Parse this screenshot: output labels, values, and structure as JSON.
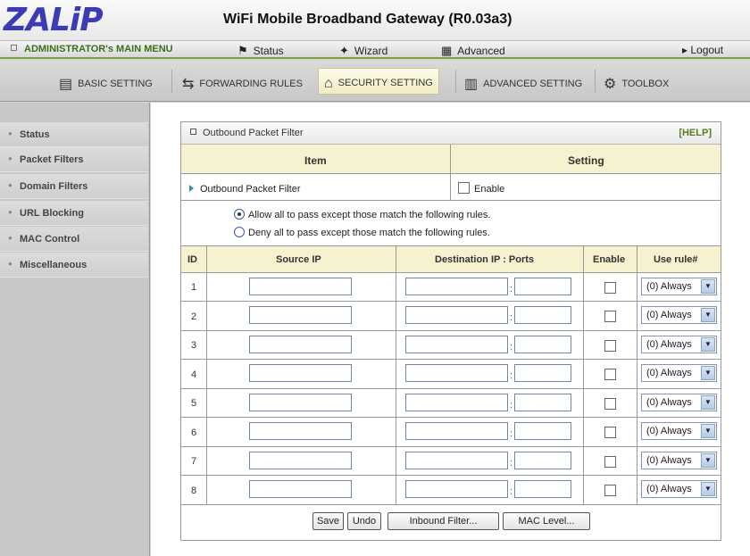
{
  "brand": {
    "logo": "ZALiP",
    "title": "WiFi Mobile Broadband Gateway (R0.03a3)"
  },
  "menu": {
    "admin_label": "ADMINISTRATOR's MAIN MENU",
    "status": "Status",
    "wizard": "Wizard",
    "advanced": "Advanced",
    "logout": "▸ Logout"
  },
  "tabs": [
    {
      "label": "BASIC SETTING",
      "icon": "basic-setting-icon",
      "active": false
    },
    {
      "label": "FORWARDING RULES",
      "icon": "forwarding-icon",
      "active": false
    },
    {
      "label": "SECURITY SETTING",
      "icon": "security-icon",
      "active": true
    },
    {
      "label": "ADVANCED SETTING",
      "icon": "advanced-setting-icon",
      "active": false
    },
    {
      "label": "TOOLBOX",
      "icon": "toolbox-icon",
      "active": false
    }
  ],
  "sidebar": {
    "items": [
      {
        "label": "Status"
      },
      {
        "label": "Packet Filters"
      },
      {
        "label": "Domain Filters"
      },
      {
        "label": "URL Blocking"
      },
      {
        "label": "MAC Control"
      },
      {
        "label": "Miscellaneous"
      }
    ]
  },
  "panel": {
    "title": "Outbound Packet Filter",
    "help": "[HELP]",
    "col_item": "Item",
    "col_setting": "Setting",
    "filter_label": "Outbound Packet Filter",
    "enable_label": "Enable",
    "radio_allow": "Allow all to pass except those match the following rules.",
    "radio_deny": "Deny all to pass except those match the following rules.",
    "rule_headers": {
      "id": "ID",
      "source_ip": "Source IP",
      "dest": "Destination IP : Ports",
      "enable": "Enable",
      "use_rule": "Use rule#"
    },
    "rows": [
      {
        "id": "1",
        "rule": "(0) Always"
      },
      {
        "id": "2",
        "rule": "(0) Always"
      },
      {
        "id": "3",
        "rule": "(0) Always"
      },
      {
        "id": "4",
        "rule": "(0) Always"
      },
      {
        "id": "5",
        "rule": "(0) Always"
      },
      {
        "id": "6",
        "rule": "(0) Always"
      },
      {
        "id": "7",
        "rule": "(0) Always"
      },
      {
        "id": "8",
        "rule": "(0) Always"
      }
    ],
    "buttons": {
      "save": "Save",
      "undo": "Undo",
      "inbound": "Inbound Filter...",
      "mac": "MAC Level..."
    }
  },
  "colors": {
    "accent_green": "#7aa23a",
    "header_bg": "#f6f2d0",
    "logo_blue": "#3b3bb6"
  }
}
